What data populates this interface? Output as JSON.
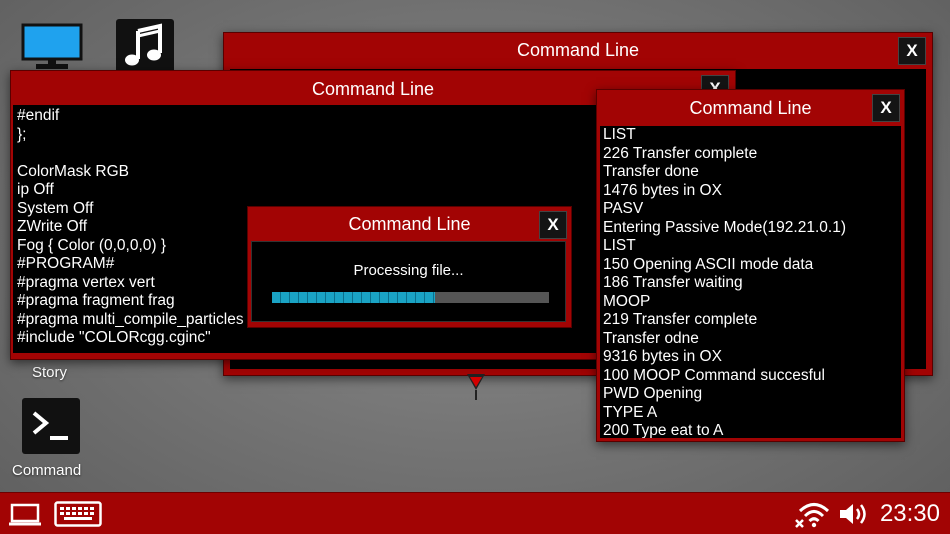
{
  "desktop": {
    "icons": [
      {
        "name": "monitor-icon",
        "label": ""
      },
      {
        "name": "music-icon",
        "label": ""
      },
      {
        "name": "story-icon",
        "label": "Story"
      },
      {
        "name": "terminal-icon",
        "label": "Command"
      }
    ]
  },
  "windows": {
    "back": {
      "title": "Command Line",
      "close_label": "X"
    },
    "left": {
      "title": "Command Line",
      "close_label": "X",
      "lines": [
        "#endif",
        "};",
        "",
        "ColorMask RGB",
        "ip Off",
        "System Off",
        "ZWrite Off",
        "Fog { Color (0,0,0,0) }",
        "#PROGRAM#",
        "#pragma vertex vert",
        "#pragma fragment frag",
        "#pragma multi_compile_particles",
        "#include \"COLORcgg.cginc\""
      ]
    },
    "right": {
      "title": "Command Line",
      "close_label": "X",
      "lines": [
        "LIST",
        "226 Transfer complete",
        "Transfer done",
        "1476 bytes in OX",
        "PASV",
        "Entering Passive Mode(192.21.0.1)",
        "LIST",
        "150 Opening ASCII mode data",
        "186 Transfer waiting",
        "MOOP",
        "219 Transfer complete",
        "Transfer odne",
        "9316 bytes in OX",
        "100 MOOP Command succesful",
        "PWD Opening",
        "TYPE A",
        "200 Type eat to A"
      ]
    },
    "progress": {
      "title": "Command Line",
      "close_label": "X",
      "message": "Processing file...",
      "progress_fraction": 0.59
    }
  },
  "taskbar": {
    "clock": "23:30",
    "icons": [
      "laptop-icon",
      "keyboard-icon",
      "wifi-off-icon",
      "volume-icon"
    ]
  },
  "colors": {
    "window_red": "#a20404",
    "progress_fill": "#1aa3c4",
    "progress_track": "#555555"
  }
}
